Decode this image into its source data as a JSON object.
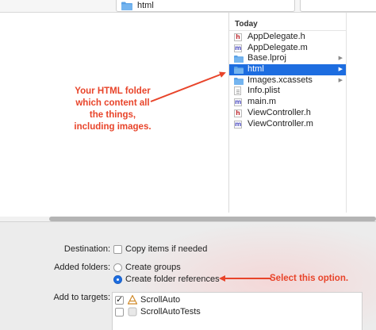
{
  "path_bar": {
    "current_folder": "html",
    "folder_color": "#5aa2e6"
  },
  "browser": {
    "column_header": "Today",
    "files": [
      {
        "name": "AppDelegate.h",
        "icon": "header-file-icon",
        "kind": "h",
        "has_children": false,
        "selected": false
      },
      {
        "name": "AppDelegate.m",
        "icon": "source-file-icon",
        "kind": "m",
        "has_children": false,
        "selected": false
      },
      {
        "name": "Base.lproj",
        "icon": "folder-icon",
        "kind": "folder",
        "has_children": true,
        "selected": false
      },
      {
        "name": "html",
        "icon": "folder-icon",
        "kind": "folder",
        "has_children": true,
        "selected": true
      },
      {
        "name": "Images.xcassets",
        "icon": "folder-icon",
        "kind": "folder",
        "has_children": true,
        "selected": false
      },
      {
        "name": "Info.plist",
        "icon": "plist-file-icon",
        "kind": "plist",
        "has_children": false,
        "selected": false
      },
      {
        "name": "main.m",
        "icon": "source-file-icon",
        "kind": "m",
        "has_children": false,
        "selected": false
      },
      {
        "name": "ViewController.h",
        "icon": "header-file-icon",
        "kind": "h",
        "has_children": false,
        "selected": false
      },
      {
        "name": "ViewController.m",
        "icon": "source-file-icon",
        "kind": "m",
        "has_children": false,
        "selected": false
      }
    ],
    "selection_color": "#1d6de0"
  },
  "options": {
    "destination_label": "Destination:",
    "copy_items_label": "Copy items if needed",
    "copy_items_checked": false,
    "added_folders_label": "Added folders:",
    "create_groups_label": "Create groups",
    "create_groups_selected": false,
    "create_folder_refs_label": "Create folder references",
    "create_folder_refs_selected": true,
    "add_to_targets_label": "Add to targets:",
    "targets": [
      {
        "name": "ScrollAuto",
        "checked": true,
        "icon": "app-target-icon"
      },
      {
        "name": "ScrollAutoTests",
        "checked": false,
        "icon": "test-target-icon"
      }
    ]
  },
  "annotations": {
    "folder_note": "Your HTML folder which content all the things, including images.",
    "folder_note_lines": [
      "Your HTML folder",
      "which content all",
      "the things,",
      "including images."
    ],
    "option_note": "Select this option.",
    "color": "#e8442a"
  }
}
